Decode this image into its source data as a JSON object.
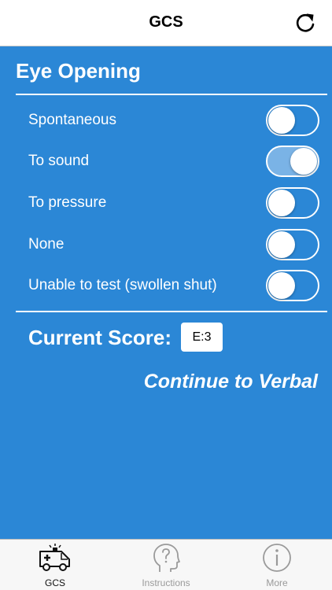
{
  "nav": {
    "title": "GCS",
    "refresh_icon": "refresh-icon"
  },
  "section": {
    "title": "Eye Opening"
  },
  "options": [
    {
      "label": "Spontaneous",
      "on": false
    },
    {
      "label": "To sound",
      "on": true
    },
    {
      "label": "To pressure",
      "on": false
    },
    {
      "label": "None",
      "on": false
    },
    {
      "label": "Unable to test (swollen shut)",
      "on": false
    }
  ],
  "score": {
    "label": "Current Score:",
    "value": "E:3"
  },
  "continue_label": "Continue to Verbal",
  "tabs": [
    {
      "label": "GCS",
      "icon": "ambulance-icon",
      "active": true
    },
    {
      "label": "Instructions",
      "icon": "head-question-icon",
      "active": false
    },
    {
      "label": "More",
      "icon": "info-icon",
      "active": false
    }
  ],
  "colors": {
    "background": "#2b87d6",
    "toggle_on": "#7ab3e6",
    "tab_active": "#111111",
    "tab_inactive": "#9a9a9a"
  }
}
